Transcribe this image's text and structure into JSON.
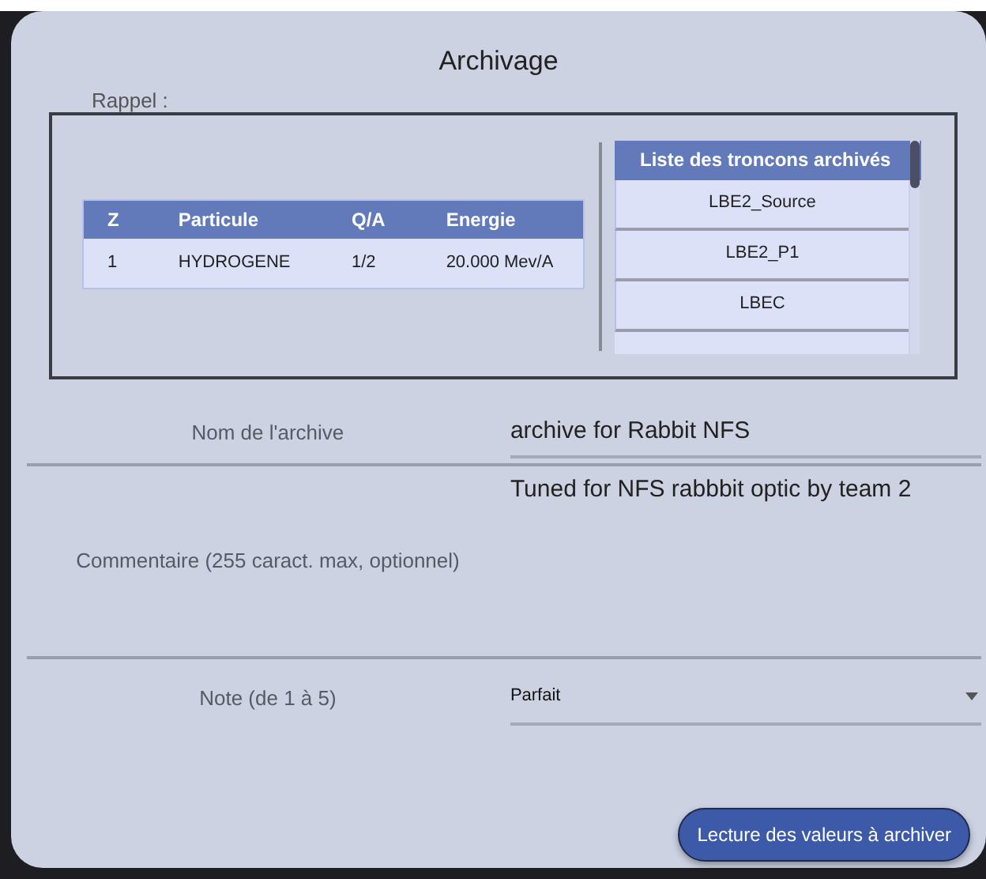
{
  "dialog": {
    "title": "Archivage"
  },
  "rappel": {
    "legend": "Rappel :",
    "particle_table": {
      "columns": [
        "Z",
        "Particule",
        "Q/A",
        "Energie"
      ],
      "rows": [
        [
          "1",
          "HYDROGENE",
          "1/2",
          "20.000 Mev/A"
        ]
      ]
    },
    "sections_list": {
      "header": "Liste des troncons archivés",
      "items": [
        "LBE2_Source",
        "LBE2_P1",
        "LBEC"
      ]
    }
  },
  "form": [
    {
      "kind": "text",
      "label": "Nom de l'archive",
      "value": "archive for Rabbit NFS"
    },
    {
      "kind": "textarea",
      "label": "Commentaire (255 caract. max, optionnel)",
      "value": "Tuned for NFS rabbbit optic by team 2"
    },
    {
      "kind": "select",
      "label": "Note (de 1 à 5)",
      "value": "Parfait"
    }
  ],
  "button": "Lecture des valeurs à archiver"
}
